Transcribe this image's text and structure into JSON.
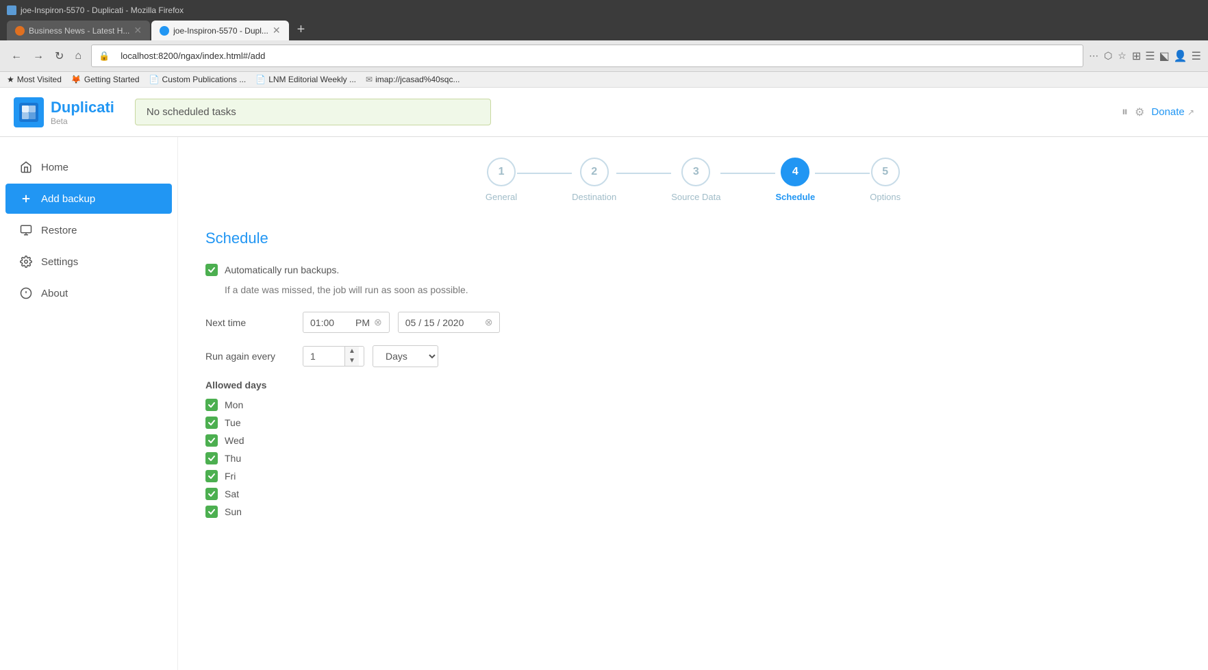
{
  "browser": {
    "title": "joe-Inspiron-5570 - Duplicati - Mozilla Firefox",
    "tabs": [
      {
        "id": "tab1",
        "label": "Business News - Latest H...",
        "favicon_color": "#e07020",
        "active": false
      },
      {
        "id": "tab2",
        "label": "joe-Inspiron-5570 - Dupl...",
        "favicon_color": "#2196F3",
        "active": true
      }
    ],
    "url": "localhost:8200/ngax/index.html#/add",
    "bookmarks": [
      {
        "id": "bk1",
        "label": "Most Visited",
        "icon": "star"
      },
      {
        "id": "bk2",
        "label": "Getting Started",
        "icon": "firefox"
      },
      {
        "id": "bk3",
        "label": "Custom Publications ...",
        "icon": "doc"
      },
      {
        "id": "bk4",
        "label": "LNM Editorial Weekly ...",
        "icon": "doc"
      },
      {
        "id": "bk5",
        "label": "imap://jcasad%40sqc...",
        "icon": "mail"
      }
    ]
  },
  "header": {
    "logo_name": "Duplicati",
    "logo_beta": "Beta",
    "status_text": "No scheduled tasks",
    "donate_label": "Donate",
    "donate_ext_icon": "↗"
  },
  "sidebar": {
    "items": [
      {
        "id": "home",
        "label": "Home",
        "icon": "home",
        "active": false
      },
      {
        "id": "add-backup",
        "label": "Add backup",
        "icon": "plus",
        "active": true
      },
      {
        "id": "restore",
        "label": "Restore",
        "icon": "monitor",
        "active": false
      },
      {
        "id": "settings",
        "label": "Settings",
        "icon": "gear",
        "active": false
      },
      {
        "id": "about",
        "label": "About",
        "icon": "info",
        "active": false
      }
    ]
  },
  "wizard": {
    "steps": [
      {
        "id": "general",
        "number": "1",
        "label": "General",
        "active": false
      },
      {
        "id": "destination",
        "number": "2",
        "label": "Destination",
        "active": false
      },
      {
        "id": "source-data",
        "number": "3",
        "label": "Source Data",
        "active": false
      },
      {
        "id": "schedule",
        "number": "4",
        "label": "Schedule",
        "active": true
      },
      {
        "id": "options",
        "number": "5",
        "label": "Options",
        "active": false
      }
    ]
  },
  "schedule": {
    "title": "Schedule",
    "auto_run_label": "Automatically run backups.",
    "missed_note": "If a date was missed, the job will run as soon as possible.",
    "next_time_label": "Next time",
    "time_value": "01:00",
    "time_period": "PM",
    "date_value": "05 / 15 / 2020",
    "run_again_label": "Run again every",
    "run_interval": "1",
    "run_unit": "Days",
    "allowed_days_label": "Allowed days",
    "days": [
      {
        "id": "mon",
        "label": "Mon",
        "checked": true
      },
      {
        "id": "tue",
        "label": "Tue",
        "checked": true
      },
      {
        "id": "wed",
        "label": "Wed",
        "checked": true
      },
      {
        "id": "thu",
        "label": "Thu",
        "checked": true
      },
      {
        "id": "fri",
        "label": "Fri",
        "checked": true
      },
      {
        "id": "sat",
        "label": "Sat",
        "checked": true
      },
      {
        "id": "sun",
        "label": "Sun",
        "checked": true
      }
    ]
  }
}
